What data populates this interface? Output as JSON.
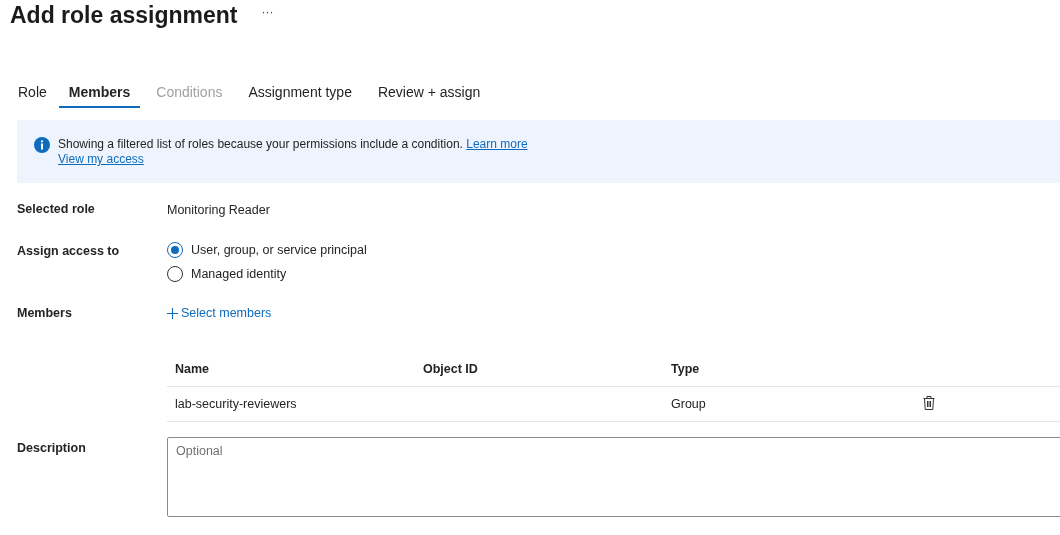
{
  "page": {
    "title": "Add role assignment",
    "more": "···"
  },
  "tabs": [
    {
      "label": "Role",
      "selected": false,
      "disabled": false
    },
    {
      "label": "Members",
      "selected": true,
      "disabled": false
    },
    {
      "label": "Conditions",
      "selected": false,
      "disabled": true
    },
    {
      "label": "Assignment type",
      "selected": false,
      "disabled": false
    },
    {
      "label": "Review + assign",
      "selected": false,
      "disabled": false
    }
  ],
  "info_banner": {
    "message": "Showing a filtered list of roles because your permissions include a condition.",
    "links": [
      "Learn more",
      "View my access"
    ]
  },
  "form": {
    "selected_role": {
      "label": "Selected role",
      "value": "Monitoring Reader"
    },
    "assign_access_to": {
      "label": "Assign access to",
      "options": [
        {
          "label": "User, group, or service principal",
          "selected": true
        },
        {
          "label": "Managed identity",
          "selected": false
        }
      ]
    },
    "members": {
      "label": "Members",
      "action": "Select members",
      "table": {
        "columns": [
          "Name",
          "Object ID",
          "Type"
        ],
        "rows": [
          {
            "name": "lab-security-reviewers",
            "type": "Group"
          }
        ]
      }
    },
    "description": {
      "label": "Description",
      "placeholder": "Optional"
    }
  }
}
